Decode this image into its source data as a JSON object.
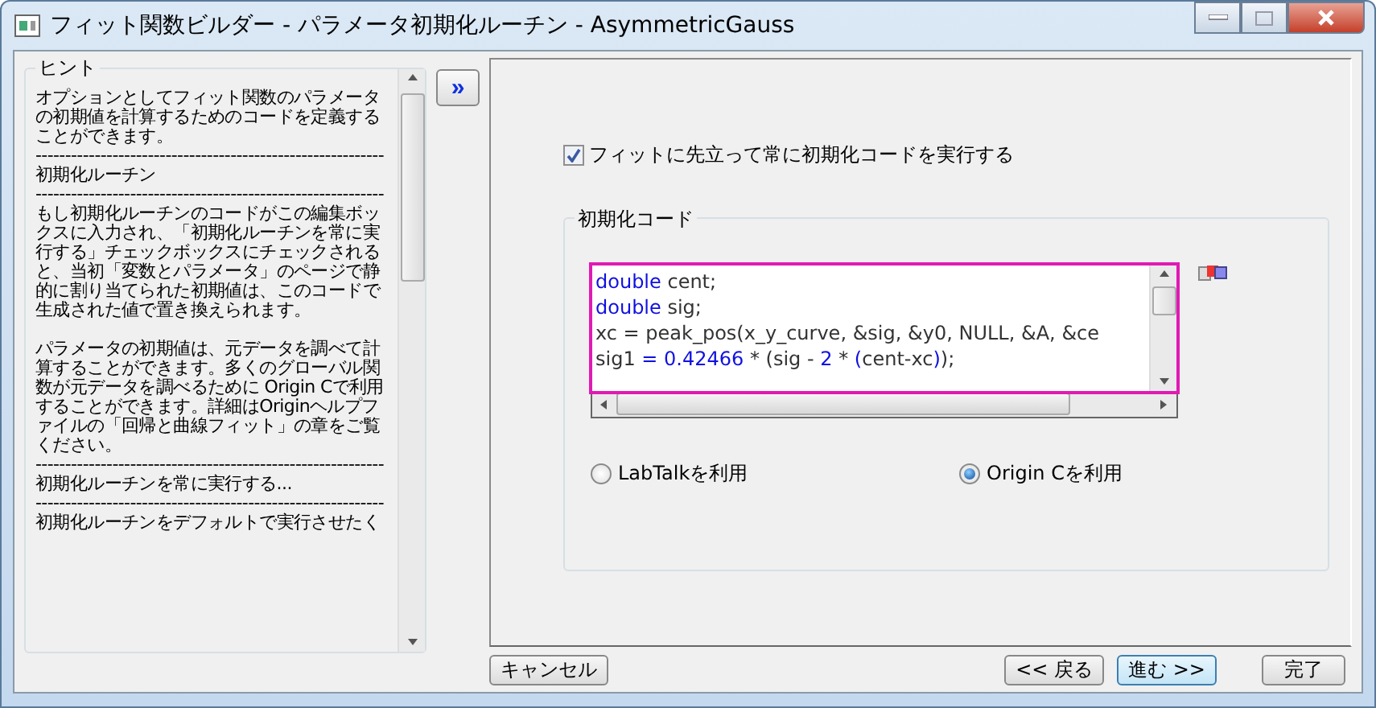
{
  "window": {
    "title": "フィット関数ビルダー - パラメータ初期化ルーチン - AsymmetricGauss"
  },
  "hint": {
    "label": "ヒント",
    "paragraphs": [
      "オプションとしてフィット関数のパラメータの初期値を計算するためのコードを定義することができます。",
      "-----------------------------------------------------------",
      "初期化ルーチン",
      "-----------------------------------------------------------",
      "もし初期化ルーチンのコードがこの編集ボックスに入力され、「初期化ルーチンを常に実行する」チェックボックスにチェックされると、当初「変数とパラメータ」のページで静的に割り当てられた初期値は、このコードで生成された値で置き換えられます。",
      "パラメータの初期値は、元データを調べて計算することができます。多くのグローバル関数が元データを調べるために Origin Cで利用することができます。詳細はOriginヘルプファイルの「回帰と曲線フィット」の章をご覧ください。",
      "-----------------------------------------------------------",
      "初期化ルーチンを常に実行する...",
      "-----------------------------------------------------------",
      "初期化ルーチンをデフォルトで実行させたく"
    ]
  },
  "expand_button": {
    "label": "»"
  },
  "run_init_checkbox": {
    "label": "フィットに先立って常に初期化コードを実行する",
    "checked": true
  },
  "code_group": {
    "label": "初期化コード",
    "lines": [
      [
        {
          "kind": "keyword",
          "text": "double"
        },
        {
          "kind": "plain",
          "text": " cent;"
        }
      ],
      [
        {
          "kind": "keyword",
          "text": "double"
        },
        {
          "kind": "plain",
          "text": " sig;"
        }
      ],
      [
        {
          "kind": "plain",
          "text": "xc = peak_pos(x_y_curve, &sig, &y0, NULL, &A, &ce"
        }
      ],
      [
        {
          "kind": "plain",
          "text": "sig1 "
        },
        {
          "kind": "number",
          "text": "= 0.42466"
        },
        {
          "kind": "plain",
          "text": " * (sig - "
        },
        {
          "kind": "number",
          "text": "2"
        },
        {
          "kind": "plain",
          "text": " * "
        },
        {
          "kind": "number",
          "text": "("
        },
        {
          "kind": "plain",
          "text": "cent-xc"
        },
        {
          "kind": "number",
          "text": ")"
        },
        {
          "kind": "plain",
          "text": ");"
        }
      ]
    ]
  },
  "language": [
    {
      "label": "LabTalkを利用",
      "selected": false
    },
    {
      "label": "Origin Cを利用",
      "selected": true
    }
  ],
  "buttons": [
    {
      "label": "キャンセル",
      "kind": "left",
      "focused": false
    },
    {
      "label": "<< 戻る",
      "kind": "right",
      "focused": false
    },
    {
      "label": "進む >>",
      "kind": "right",
      "focused": true
    },
    {
      "label": "完了",
      "kind": "right",
      "focused": false
    }
  ]
}
